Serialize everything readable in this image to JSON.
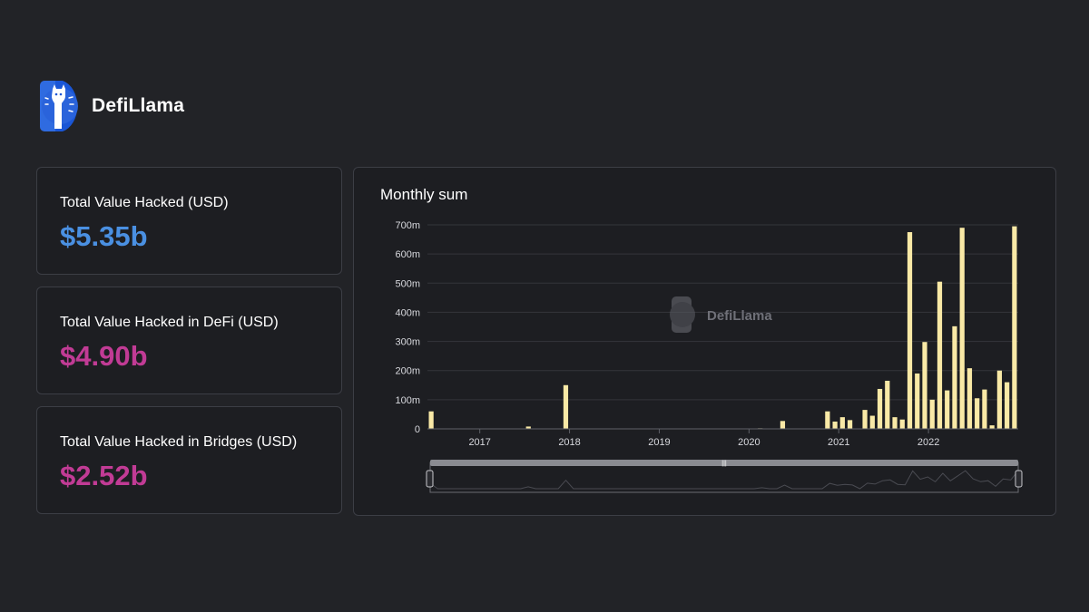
{
  "brand": {
    "name": "DefiLlama"
  },
  "cards": [
    {
      "label": "Total Value Hacked (USD)",
      "value": "$5.35b",
      "color": "#4a90e2"
    },
    {
      "label": "Total Value Hacked in DeFi (USD)",
      "value": "$4.90b",
      "color": "#c13b95"
    },
    {
      "label": "Total Value Hacked in Bridges (USD)",
      "value": "$2.52b",
      "color": "#c13b95"
    }
  ],
  "colors": {
    "bar": "#f9e9a6",
    "grid": "#34353b",
    "axis": "#5e6068"
  },
  "chart_data": {
    "type": "bar",
    "title": "Monthly sum",
    "watermark": "DefiLlama",
    "xlabel": "",
    "ylabel": "",
    "ylim": [
      0,
      700
    ],
    "y_ticks": [
      "0",
      "100m",
      "200m",
      "300m",
      "400m",
      "500m",
      "600m",
      "700m"
    ],
    "x_ticks": [
      {
        "label": "2017",
        "month": 7
      },
      {
        "label": "2018",
        "month": 19
      },
      {
        "label": "2019",
        "month": 31
      },
      {
        "label": "2020",
        "month": 43
      },
      {
        "label": "2021",
        "month": 55
      },
      {
        "label": "2022",
        "month": 67
      }
    ],
    "grid": true,
    "series": [
      {
        "values": [
          60,
          0,
          0,
          0,
          0,
          0,
          0,
          0,
          0,
          0,
          0,
          0,
          0,
          8,
          0,
          0,
          0,
          0,
          150,
          0,
          0,
          0,
          0,
          0,
          0,
          0,
          0,
          0,
          0,
          0,
          0,
          0,
          0,
          0,
          0,
          0,
          0,
          0,
          0,
          0,
          0,
          0,
          0,
          0,
          2,
          0,
          0,
          27,
          0,
          0,
          0,
          0,
          0,
          60,
          25,
          40,
          30,
          0,
          65,
          45,
          137,
          165,
          40,
          32,
          675,
          190,
          298,
          100,
          505,
          132,
          352,
          690,
          208,
          105,
          135,
          12,
          200,
          160,
          695
        ]
      }
    ],
    "zoom_navigator": {
      "visible": true,
      "range": "full"
    }
  }
}
